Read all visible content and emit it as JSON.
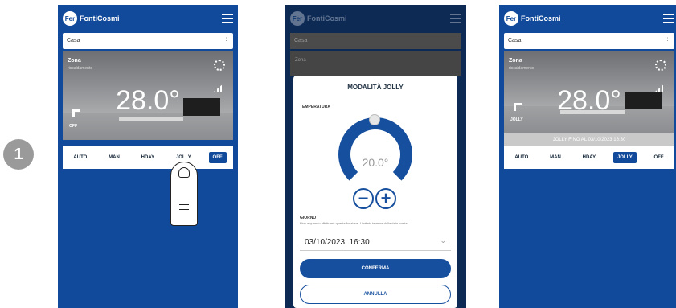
{
  "step": "1",
  "app": {
    "brand": "FontiCosmi",
    "logo_letters": "Fer"
  },
  "house": "Casa",
  "zone": {
    "name": "Zona",
    "sub": "riscaldamento",
    "temperature": "28.0°"
  },
  "modes": [
    "AUTO",
    "MAN",
    "HDAY",
    "JOLLY",
    "OFF"
  ],
  "screen1": {
    "current_mode_caption": "OFF",
    "active_mode": "OFF"
  },
  "screen2": {
    "modal_title": "MODALITÀ JOLLY",
    "temperature_label": "TEMPERATURA",
    "temperature_value": "20.0°",
    "minus": "−",
    "plus": "+",
    "period_label": "GIORNO",
    "period_note": "Fino a quando effettuare questa funzione. Limitata termine dalla data scelta.",
    "datetime": "03/10/2023, 16:30",
    "confirm": "CONFERMA",
    "cancel": "ANNULLA"
  },
  "screen3": {
    "current_mode_caption": "JOLLY",
    "banner": "JOLLY FINO AL 03/10/2023 16:30",
    "active_mode": "JOLLY"
  }
}
